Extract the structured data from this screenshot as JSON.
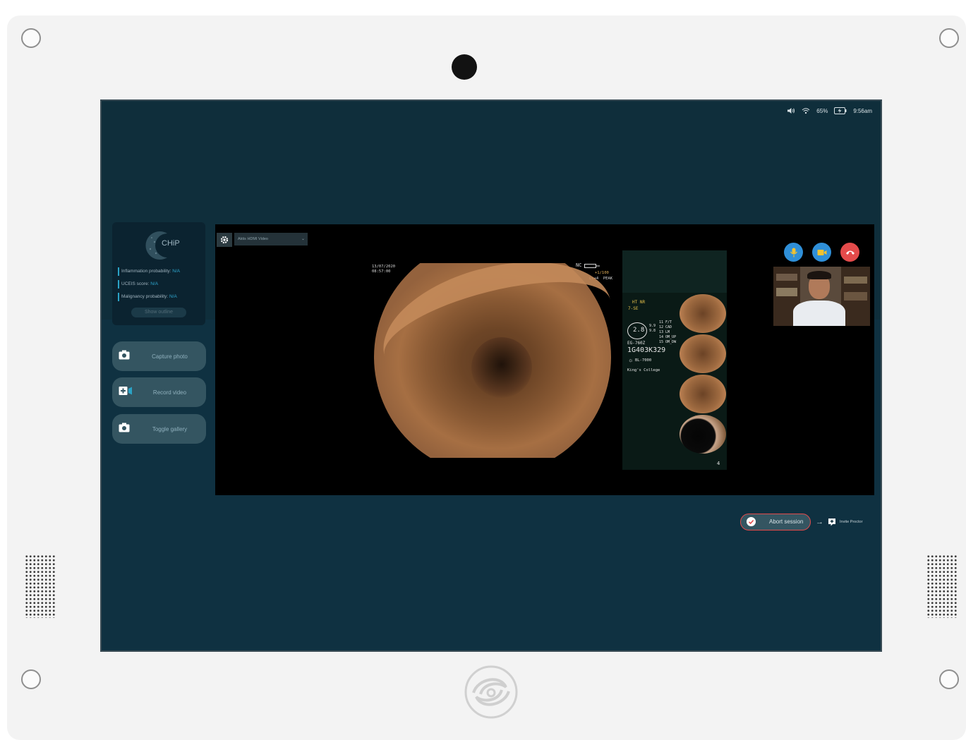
{
  "status_bar": {
    "battery": "65%",
    "time": "9:56am"
  },
  "chip_panel": {
    "logo_text": "CHiP",
    "metrics": [
      {
        "label": "Inflammation probability:",
        "value": "N/A"
      },
      {
        "label": "UCEIS score:",
        "value": "N/A"
      },
      {
        "label": "Malignancy probability:",
        "value": "N/A"
      }
    ],
    "show_outline": "Show outline"
  },
  "side_buttons": {
    "capture": "Capture photo",
    "record": "Record video",
    "gallery": "Toggle gallery"
  },
  "video": {
    "source_select": "Aktis HDMI Video",
    "overlay": {
      "date": "13/07/2020",
      "time": "08:57:00",
      "nc": "NC",
      "ratio": "+1/100",
      "lv": "Lv+4  PEAK",
      "ht": "HT NR",
      "se": "7-SE",
      "ne": "2.8",
      "list": "9.9\n9.8",
      "model": "EG-760Z",
      "serial": "1G403K329",
      "light": "BL-7000",
      "hospital": "King's College",
      "menu": "11 F/T\n12 CAD\n13 LM\n14 OM_UP\n15 OM_DW",
      "count": "4"
    }
  },
  "session": {
    "abort": "Abort session",
    "invite": "Invite Proctor"
  },
  "colors": {
    "screen_bg": "#0f2e3b",
    "button_bg": "#345561",
    "accent_blue": "#2f8fd8",
    "end_call_red": "#e44b4b"
  }
}
